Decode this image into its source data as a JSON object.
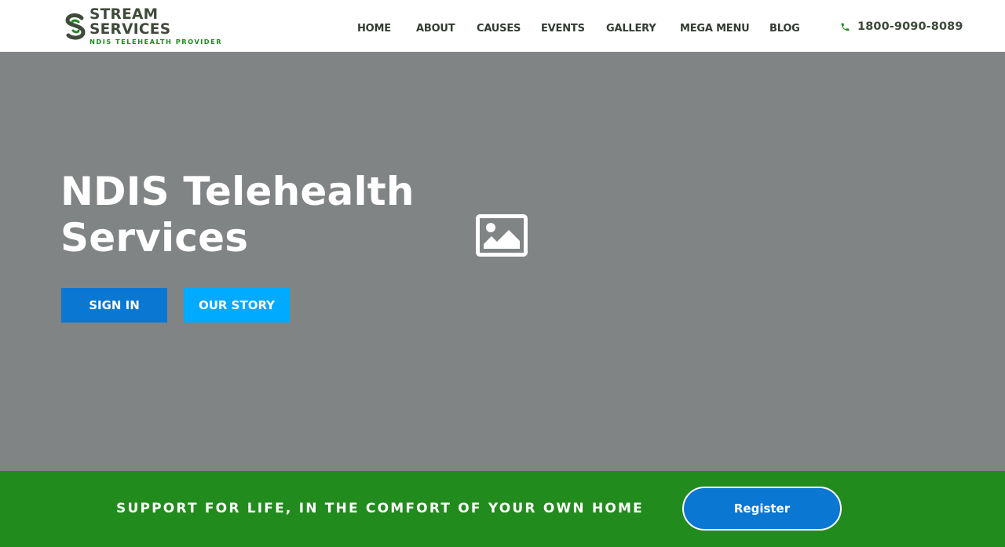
{
  "header": {
    "logo": {
      "title": "STREAM SERVICES",
      "subtitle": "NDIS TELEHEALTH PROVIDER",
      "icon": "stream-services-logo-icon"
    },
    "nav": [
      {
        "label": "HOME"
      },
      {
        "label": "ABOUT"
      },
      {
        "label": "CAUSES"
      },
      {
        "label": "EVENTS"
      },
      {
        "label": "GALLERY"
      },
      {
        "label": "MEGA MENU"
      },
      {
        "label": "BLOG"
      }
    ],
    "phone": {
      "icon": "phone-icon",
      "number": "1800-9090-8089"
    }
  },
  "hero": {
    "title_line1": "NDIS Telehealth",
    "title_line2": "Services",
    "primary_button": "SIGN IN",
    "secondary_button": "OUR STORY",
    "image_icon": "image-placeholder-icon"
  },
  "cta": {
    "text": "SUPPORT FOR LIFE, IN THE COMFORT OF YOUR OWN HOME",
    "button": "Register"
  },
  "colors": {
    "brand_green": "#228b1d",
    "primary_blue": "#0a77d2",
    "secondary_blue": "#00aaff",
    "hero_background": "#808485",
    "nav_text": "#333b33"
  }
}
